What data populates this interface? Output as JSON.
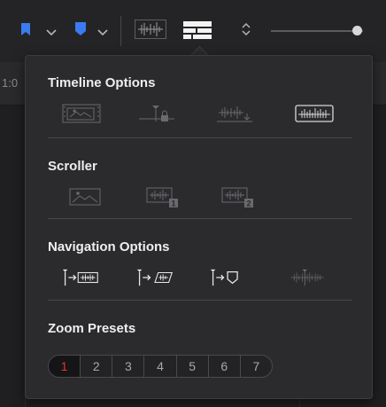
{
  "background": {
    "ruler_text": "1:0"
  },
  "toolbar": {
    "icons": [
      "flag-icon",
      "chevron-down-icon",
      "marker-icon",
      "chevron-down-icon",
      "audio-waveform-icon",
      "timeline-view-icon",
      "up-down-chevron-icon"
    ],
    "zoom_slider_level": 0.88
  },
  "popover": {
    "sections": {
      "timeline_options": {
        "title": "Timeline Options"
      },
      "scroller": {
        "title": "Scroller"
      },
      "navigation_options": {
        "title": "Navigation Options"
      },
      "zoom_presets": {
        "title": "Zoom Presets"
      }
    },
    "zoom_presets": [
      "1",
      "2",
      "3",
      "4",
      "5",
      "6",
      "7"
    ],
    "active_zoom_preset": "1"
  },
  "colors": {
    "accent_blue": "#3a7bf0",
    "active_red": "#e0362c",
    "popover_bg": "#2b2b2d"
  }
}
